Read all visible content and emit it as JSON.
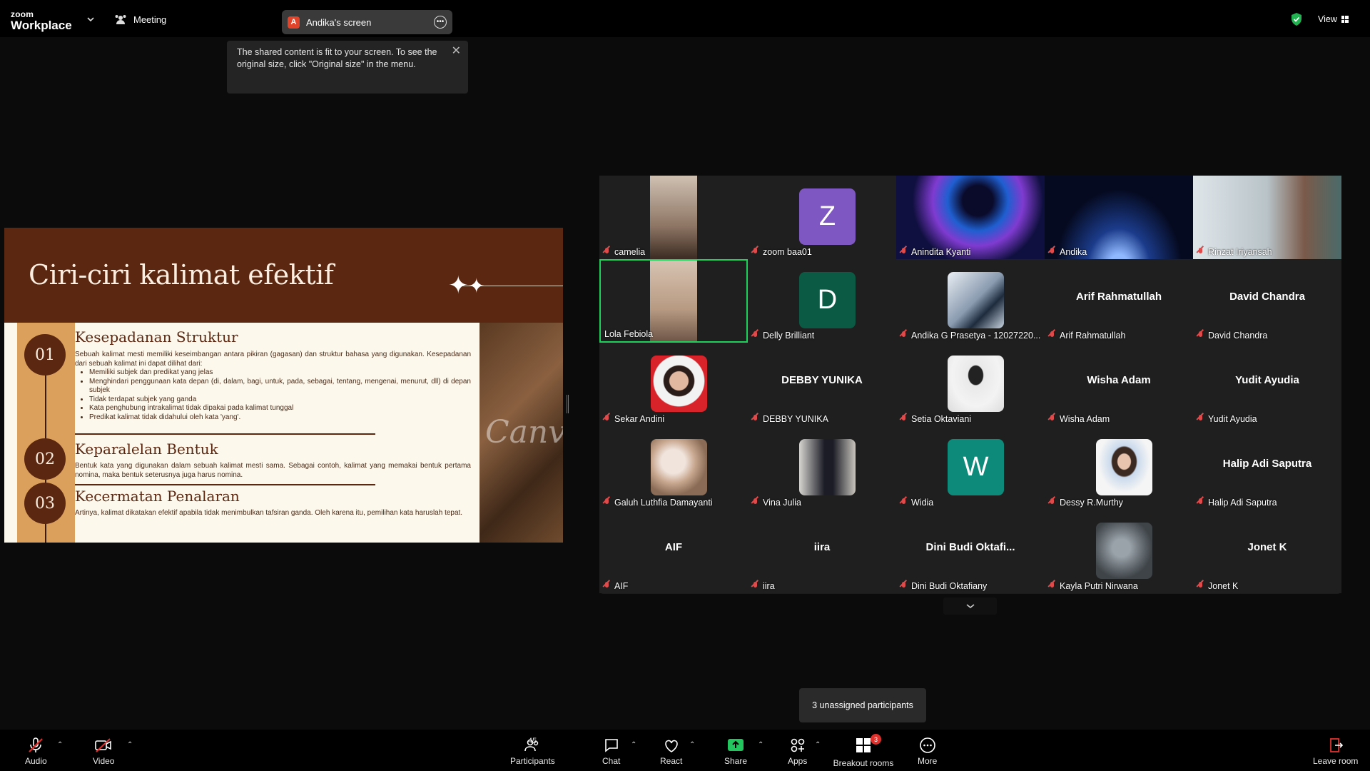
{
  "app": {
    "logo_top": "zoom",
    "logo_bottom": "Workplace",
    "meeting_label": "Meeting",
    "view_label": "View"
  },
  "share": {
    "avatar_letter": "A",
    "label": "Andika's screen"
  },
  "tooltip": {
    "text": "The shared content is fit to your screen. To see the original size, click \"Original size\" in the menu."
  },
  "slide": {
    "title": "Ciri-ciri kalimat efektif",
    "watermark": "Canva",
    "sections": [
      {
        "num": "01",
        "heading": "Kesepadanan Struktur",
        "body": "Sebuah kalimat mesti memiliki keseimbangan antara pikiran (gagasan) dan struktur bahasa yang digunakan. Kesepadanan dari sebuah kalimat ini dapat dilihat dari:",
        "bullets": [
          "Memiliki subjek dan predikat yang jelas",
          "Menghindari penggunaan kata depan (di, dalam, bagi, untuk, pada, sebagai, tentang, mengenai, menurut, dll) di depan subjek",
          "Tidak terdapat subjek yang ganda",
          "Kata penghubung intrakalimat tidak dipakai pada kalimat tunggal",
          "Predikat kalimat tidak didahului oleh kata 'yang'."
        ]
      },
      {
        "num": "02",
        "heading": "Keparalelan Bentuk",
        "body": "Bentuk kata yang digunakan dalam sebuah kalimat mesti sama. Sebagai contoh, kalimat yang memakai bentuk pertama nomina, maka bentuk seterusnya juga harus nomina."
      },
      {
        "num": "03",
        "heading": "Kecermatan Penalaran",
        "body": "Artinya, kalimat dikatakan efektif apabila tidak menimbulkan tafsiran ganda. Oleh karena itu, pemilihan kata haruslah tepat."
      }
    ]
  },
  "participants": [
    {
      "name": "camelia",
      "type": "video"
    },
    {
      "name": "zoom baa01",
      "type": "letter",
      "letter": "Z",
      "color": "#7e57c2"
    },
    {
      "name": "Anindita Kyanti",
      "type": "video"
    },
    {
      "name": "Andika",
      "type": "video"
    },
    {
      "name": "Rinzat Iriyansah",
      "type": "video"
    },
    {
      "name": "Lola Febiola",
      "type": "video",
      "active": true
    },
    {
      "name": "Delly Brilliant",
      "type": "letter",
      "letter": "D",
      "color": "#0b5a44"
    },
    {
      "name": "Andika G Prasetya - 12027220...",
      "type": "photo"
    },
    {
      "name": "Arif Rahmatullah",
      "type": "text"
    },
    {
      "name": "David Chandra",
      "type": "text"
    },
    {
      "name": "Sekar Andini",
      "type": "photo"
    },
    {
      "name": "DEBBY YUNIKA",
      "type": "text"
    },
    {
      "name": "Setia Oktaviani",
      "type": "photo"
    },
    {
      "name": "Wisha Adam",
      "type": "text"
    },
    {
      "name": "Yudit Ayudia",
      "type": "text"
    },
    {
      "name": "Galuh Luthfia Damayanti",
      "type": "photo"
    },
    {
      "name": "Vina Julia",
      "type": "photo"
    },
    {
      "name": "Widia",
      "type": "letter",
      "letter": "W",
      "color": "#0e8a7a"
    },
    {
      "name": "Dessy R.Murthy",
      "type": "photo"
    },
    {
      "name": "Halip Adi Saputra",
      "type": "text"
    },
    {
      "name": "AIF",
      "type": "text"
    },
    {
      "name": "iira",
      "type": "text"
    },
    {
      "name": "Dini Budi Oktafiany",
      "type": "text",
      "display": "Dini  Budi  Oktafi..."
    },
    {
      "name": "Kayla Putri Nirwana",
      "type": "photo"
    },
    {
      "name": "Jonet K",
      "type": "text"
    }
  ],
  "unassigned": "3 unassigned participants",
  "toolbar": {
    "audio": "Audio",
    "video": "Video",
    "participants": "Participants",
    "participants_count": "45",
    "chat": "Chat",
    "react": "React",
    "share": "Share",
    "apps": "Apps",
    "breakout": "Breakout rooms",
    "breakout_badge": "3",
    "more": "More",
    "leave": "Leave room"
  }
}
